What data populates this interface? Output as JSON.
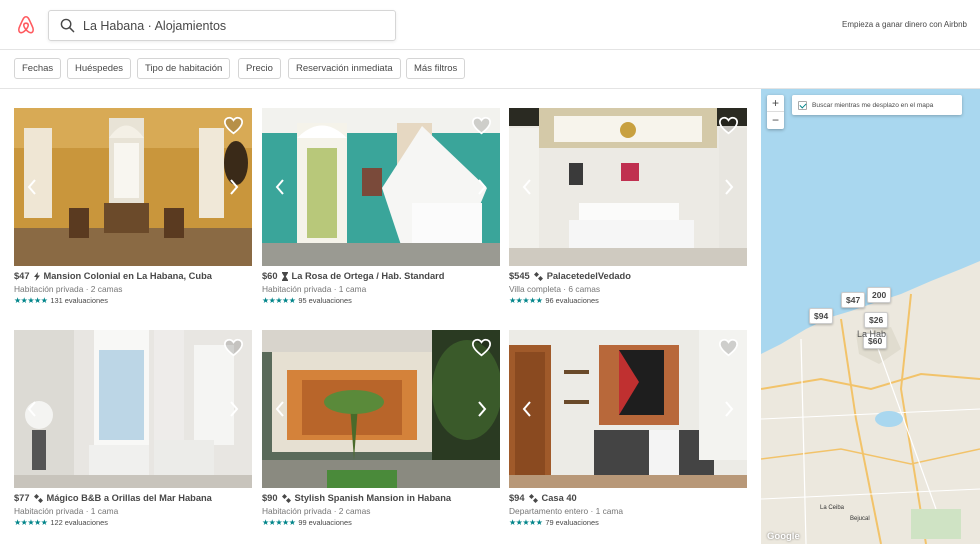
{
  "header": {
    "search_query": "La Habana · Alojamientos",
    "host_link": "Empieza a ganar dinero con Airbnb",
    "brand_color": "#FF5A5F"
  },
  "filters": [
    "Fechas",
    "Huéspedes",
    "Tipo de habitación",
    "Precio",
    "Reservación inmediata",
    "Más filtros"
  ],
  "listings": [
    {
      "price": "$47",
      "name": "Mansion Colonial en La Habana, Cuba",
      "type": "Habitación privada · 2 camas",
      "stars": "★★★★★",
      "reviews": "131 evaluaciones",
      "badge": "bolt-icon"
    },
    {
      "price": "$60",
      "name": "La Rosa de Ortega / Hab. Standard",
      "type": "Habitación privada · 1 cama",
      "stars": "★★★★★",
      "reviews": "95 evaluaciones",
      "badge": "hourglass-icon"
    },
    {
      "price": "$545",
      "name": "PalacetedelVedado",
      "type": "Villa completa · 6 camas",
      "stars": "★★★★★",
      "reviews": "96 evaluaciones",
      "badge": "superhost-bolt-icon"
    },
    {
      "price": "$77",
      "name": "Mágico B&B a Orillas del Mar Habana",
      "type": "Habitación privada · 1 cama",
      "stars": "★★★★★",
      "reviews": "122 evaluaciones",
      "badge": "superhost-bolt-icon"
    },
    {
      "price": "$90",
      "name": "Stylish Spanish Mansion in Habana",
      "type": "Habitación privada · 2 camas",
      "stars": "★★★★★",
      "reviews": "99 evaluaciones",
      "badge": "superhost-bolt-icon"
    },
    {
      "price": "$94",
      "name": "Casa 40",
      "type": "Departamento entero · 1 cama",
      "stars": "★★★★★",
      "reviews": "79 evaluaciones",
      "badge": "superhost-bolt-icon"
    }
  ],
  "map": {
    "search_toggle": "Buscar mientras me desplazo en el mapa",
    "zoom_in": "+",
    "zoom_out": "−",
    "pins": [
      "$47",
      "200",
      "$94",
      "$26",
      "$60"
    ],
    "labels": [
      "La Hab",
      "La Ceiba",
      "Bejucal"
    ],
    "attribution": "Google"
  }
}
